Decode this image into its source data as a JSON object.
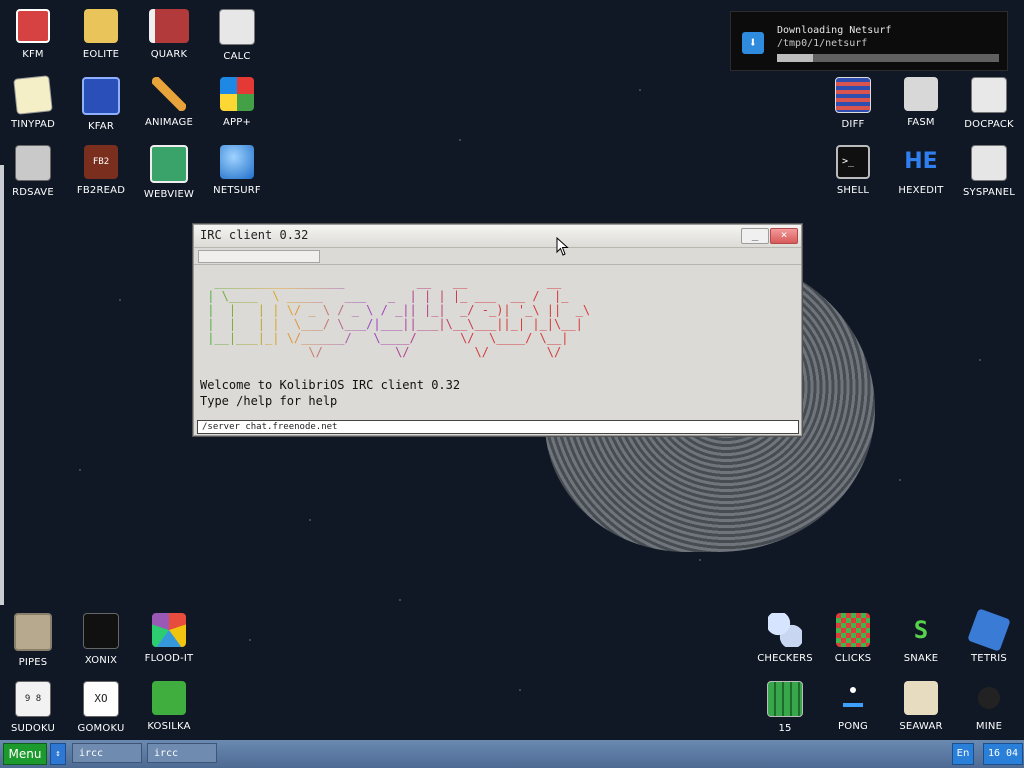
{
  "desktop": {
    "icons": [
      {
        "label": "KFM",
        "icon": "floppy-icon"
      },
      {
        "label": "EOLITE",
        "icon": "folder-icon"
      },
      {
        "label": "QUARK",
        "icon": "book-icon"
      },
      {
        "label": "CALC",
        "icon": "calculator-icon"
      },
      {
        "label": "TINYPAD",
        "icon": "notepad-icon"
      },
      {
        "label": "KFAR",
        "icon": "panels-icon"
      },
      {
        "label": "ANIMAGE",
        "icon": "pencil-icon"
      },
      {
        "label": "APP+",
        "icon": "cube-icon"
      },
      {
        "label": "RDSAVE",
        "icon": "disk-save-icon"
      },
      {
        "label": "FB2READ",
        "icon": "fb2-book-icon"
      },
      {
        "label": "WEBVIEW",
        "icon": "web-image-icon"
      },
      {
        "label": "NETSURF",
        "icon": "globe-icon"
      },
      {
        "label": "DIFF",
        "icon": "diff-icon"
      },
      {
        "label": "FASM",
        "icon": "fasm-icon"
      },
      {
        "label": "DOCPACK",
        "icon": "cabinet-icon"
      },
      {
        "label": "SHELL",
        "icon": "terminal-icon"
      },
      {
        "label": "HEXEDIT",
        "icon": "hex-icon"
      },
      {
        "label": "SYSPANEL",
        "icon": "sliders-icon"
      },
      {
        "label": "PIPES",
        "icon": "pipes-icon"
      },
      {
        "label": "XONIX",
        "icon": "xonix-icon"
      },
      {
        "label": "FLOOD-IT",
        "icon": "color-grid-icon"
      },
      {
        "label": "SUDOKU",
        "icon": "sudoku-icon"
      },
      {
        "label": "GOMOKU",
        "icon": "gomoku-icon"
      },
      {
        "label": "KOSILKA",
        "icon": "lawnmower-icon"
      },
      {
        "label": "CHECKERS",
        "icon": "checkers-icon"
      },
      {
        "label": "CLICKS",
        "icon": "blocks-icon"
      },
      {
        "label": "SNAKE",
        "icon": "snake-icon"
      },
      {
        "label": "TETRIS",
        "icon": "tetris-icon"
      },
      {
        "label": "15",
        "icon": "fifteen-puzzle-icon"
      },
      {
        "label": "PONG",
        "icon": "pong-icon"
      },
      {
        "label": "SEAWAR",
        "icon": "battleship-icon"
      },
      {
        "label": "MINE",
        "icon": "mine-icon"
      }
    ]
  },
  "notification": {
    "title": "Downloading Netsurf",
    "path": "/tmp0/1/netsurf",
    "progress": 0.16
  },
  "irc": {
    "title": "IRC client 0.32",
    "min_label": "_",
    "close_label": "×",
    "ascii_rows": [
      "  __________________          __   __           __",
      " | \\____  \\ _____   ___   _  | | | |_ ___  __ /  |_",
      " |  |   | | \\/ _ \\ / _ \\ / _|| |_|  _/ -_)| '_\\ ||  _\\",
      " |  |   | |  \\___/ \\___/|___||___|\\__\\___||_| |_|\\__|",
      " |__|___|_| \\/______/   \\____/      \\/  \\____/ \\__|",
      "               \\/          \\/         \\/        \\/"
    ],
    "messages": [
      "Welcome to KolibriOS IRC client 0.32",
      "Type /help for help"
    ],
    "input_value": "/server chat.freenode.net"
  },
  "taskbar": {
    "menu_label": "Menu",
    "arrow_label": "↕",
    "tasks": [
      "ircc",
      "ircc"
    ],
    "lang": "En",
    "clock": "16 04"
  },
  "colors": {
    "ascii_gradient": [
      "#3fb14a",
      "#e6a52b",
      "#9c46c7",
      "#d23c3c"
    ]
  }
}
